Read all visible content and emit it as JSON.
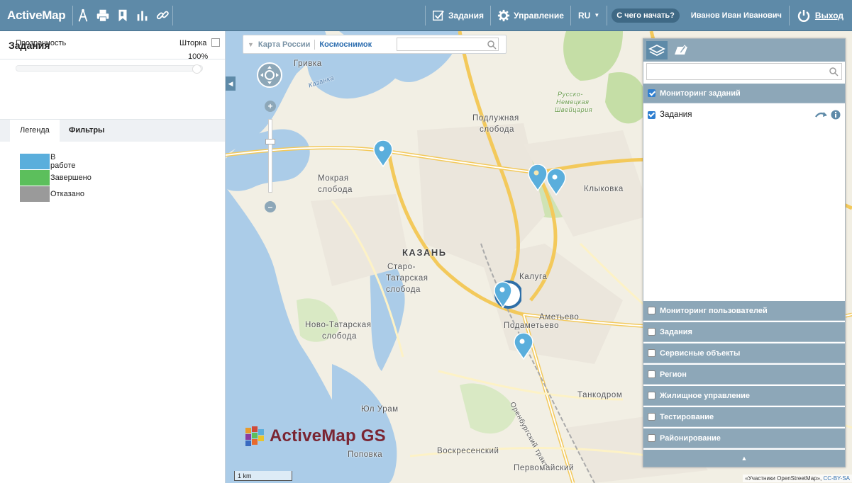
{
  "topbar": {
    "brand": "ActiveMap",
    "tasks_label": "Задания",
    "manage_label": "Управление",
    "lang_label": "RU",
    "start_label": "С чего начать?",
    "user_name": "Иванов Иван Иванович",
    "logout_label": "Выход",
    "color": "#5e8aa8"
  },
  "left_panel": {
    "title": "Задания",
    "opacity_label": "Прозрачность",
    "curtain_label": "Шторка",
    "opacity_value": "100%",
    "opacity_fraction": 1.0,
    "tabs": {
      "legend": "Легенда",
      "filters": "Фильтры"
    },
    "legend": [
      {
        "label": "В работе",
        "color": "#5aaedc"
      },
      {
        "label": "Завершено",
        "color": "#5cbf5c"
      },
      {
        "label": "Отказано",
        "color": "#9a9a9a"
      }
    ]
  },
  "map": {
    "layer_switch": {
      "russia": "Карта России",
      "satellite": "Космоснимок"
    },
    "places": {
      "city": "КАЗАНЬ",
      "grivka": "Гривка",
      "podluzhnaya1": "Подлужная",
      "podluzhnaya2": "слобода",
      "mokraya1": "Мокрая",
      "mokraya2": "слобода",
      "klykovka": "Клыковка",
      "starotatar1": "Старо-",
      "starotatar2": "Татарская",
      "starotatar3": "слобода",
      "kaluga": "Калуга",
      "ametevo": "Аметьево",
      "podametevo": "Подаметьево",
      "novotatar1": "Ново-Татарская",
      "novotatar2": "слобода",
      "tankodrom": "Танкодром",
      "yulurm": "Юл Урам",
      "voskres": "Воскресенский",
      "pervomai": "Первомайский",
      "popovka": "Поповка",
      "orenburg": "Оренбургский тракт",
      "russko1": "Русско-",
      "russko2": "Немецкая",
      "russko3": "Швейцария",
      "kazan_river": "Казанка"
    },
    "logo": "ActiveMap GS",
    "scale": "1 km",
    "attribution": "«Участники OpenStreetMap»,",
    "attribution_link": "CC-BY-SA",
    "pin_color": "#5aaedc"
  },
  "right_panel": {
    "groups_top": {
      "label": "Мониторинг заданий",
      "checked": true
    },
    "sub_item": {
      "label": "Задания",
      "checked": true
    },
    "groups": [
      {
        "label": "Мониторинг пользователей",
        "checked": false
      },
      {
        "label": "Задания",
        "checked": false
      },
      {
        "label": "Сервисные объекты",
        "checked": false
      },
      {
        "label": "Регион",
        "checked": false
      },
      {
        "label": "Жилищное управление",
        "checked": false
      },
      {
        "label": "Тестирование",
        "checked": false
      },
      {
        "label": "Районирование",
        "checked": false
      }
    ]
  }
}
